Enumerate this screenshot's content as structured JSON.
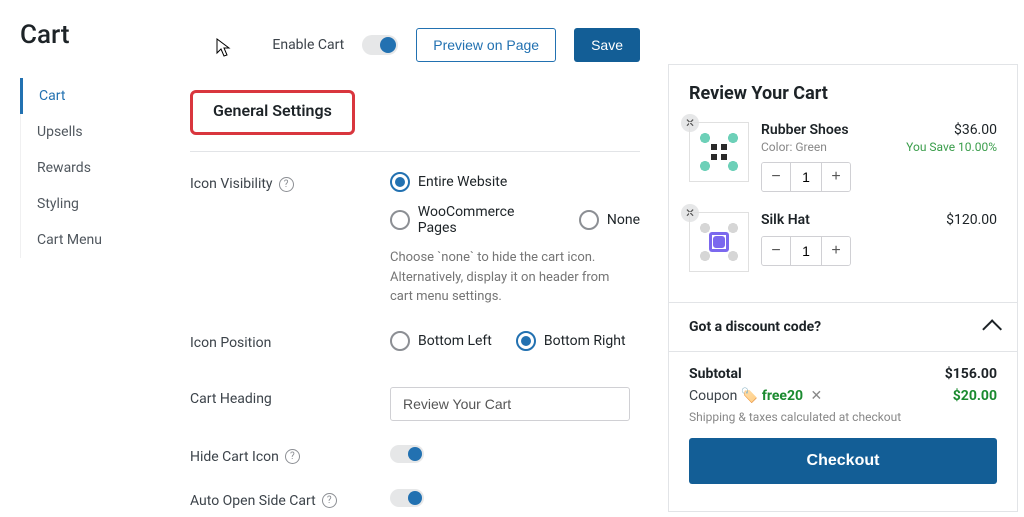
{
  "page": {
    "title": "Cart"
  },
  "nav": {
    "items": [
      {
        "label": "Cart",
        "active": true
      },
      {
        "label": "Upsells"
      },
      {
        "label": "Rewards"
      },
      {
        "label": "Styling"
      },
      {
        "label": "Cart Menu"
      }
    ]
  },
  "toolbar": {
    "enable_label": "Enable Cart",
    "enable_on": true,
    "preview_label": "Preview on Page",
    "save_label": "Save"
  },
  "section": {
    "title": "General Settings",
    "fields": {
      "icon_visibility": {
        "label": "Icon Visibility",
        "options": [
          "Entire Website",
          "WooCommerce Pages",
          "None"
        ],
        "selected": "Entire Website",
        "help": "Choose `none` to hide the cart icon. Alternatively, display it on header from cart menu settings."
      },
      "icon_position": {
        "label": "Icon Position",
        "options": [
          "Bottom Left",
          "Bottom Right"
        ],
        "selected": "Bottom Right"
      },
      "cart_heading": {
        "label": "Cart Heading",
        "value": "Review Your Cart"
      },
      "hide_cart_icon": {
        "label": "Hide Cart Icon",
        "on": true
      },
      "auto_open": {
        "label": "Auto Open Side Cart",
        "on": true
      }
    }
  },
  "preview": {
    "title": "Review Your Cart",
    "items": [
      {
        "name": "Rubber Shoes",
        "meta": "Color: Green",
        "price": "$36.00",
        "save": "You Save 10.00%",
        "qty": 1,
        "thumb": "green"
      },
      {
        "name": "Silk Hat",
        "meta": "",
        "price": "$120.00",
        "save": "",
        "qty": 1,
        "thumb": "purple"
      }
    ],
    "discount_heading": "Got a discount code?",
    "subtotal_label": "Subtotal",
    "subtotal": "$156.00",
    "coupon_label": "Coupon",
    "coupon_code": "free20",
    "coupon_value": "$20.00",
    "tax_note": "Shipping & taxes calculated at checkout",
    "checkout_label": "Checkout"
  }
}
